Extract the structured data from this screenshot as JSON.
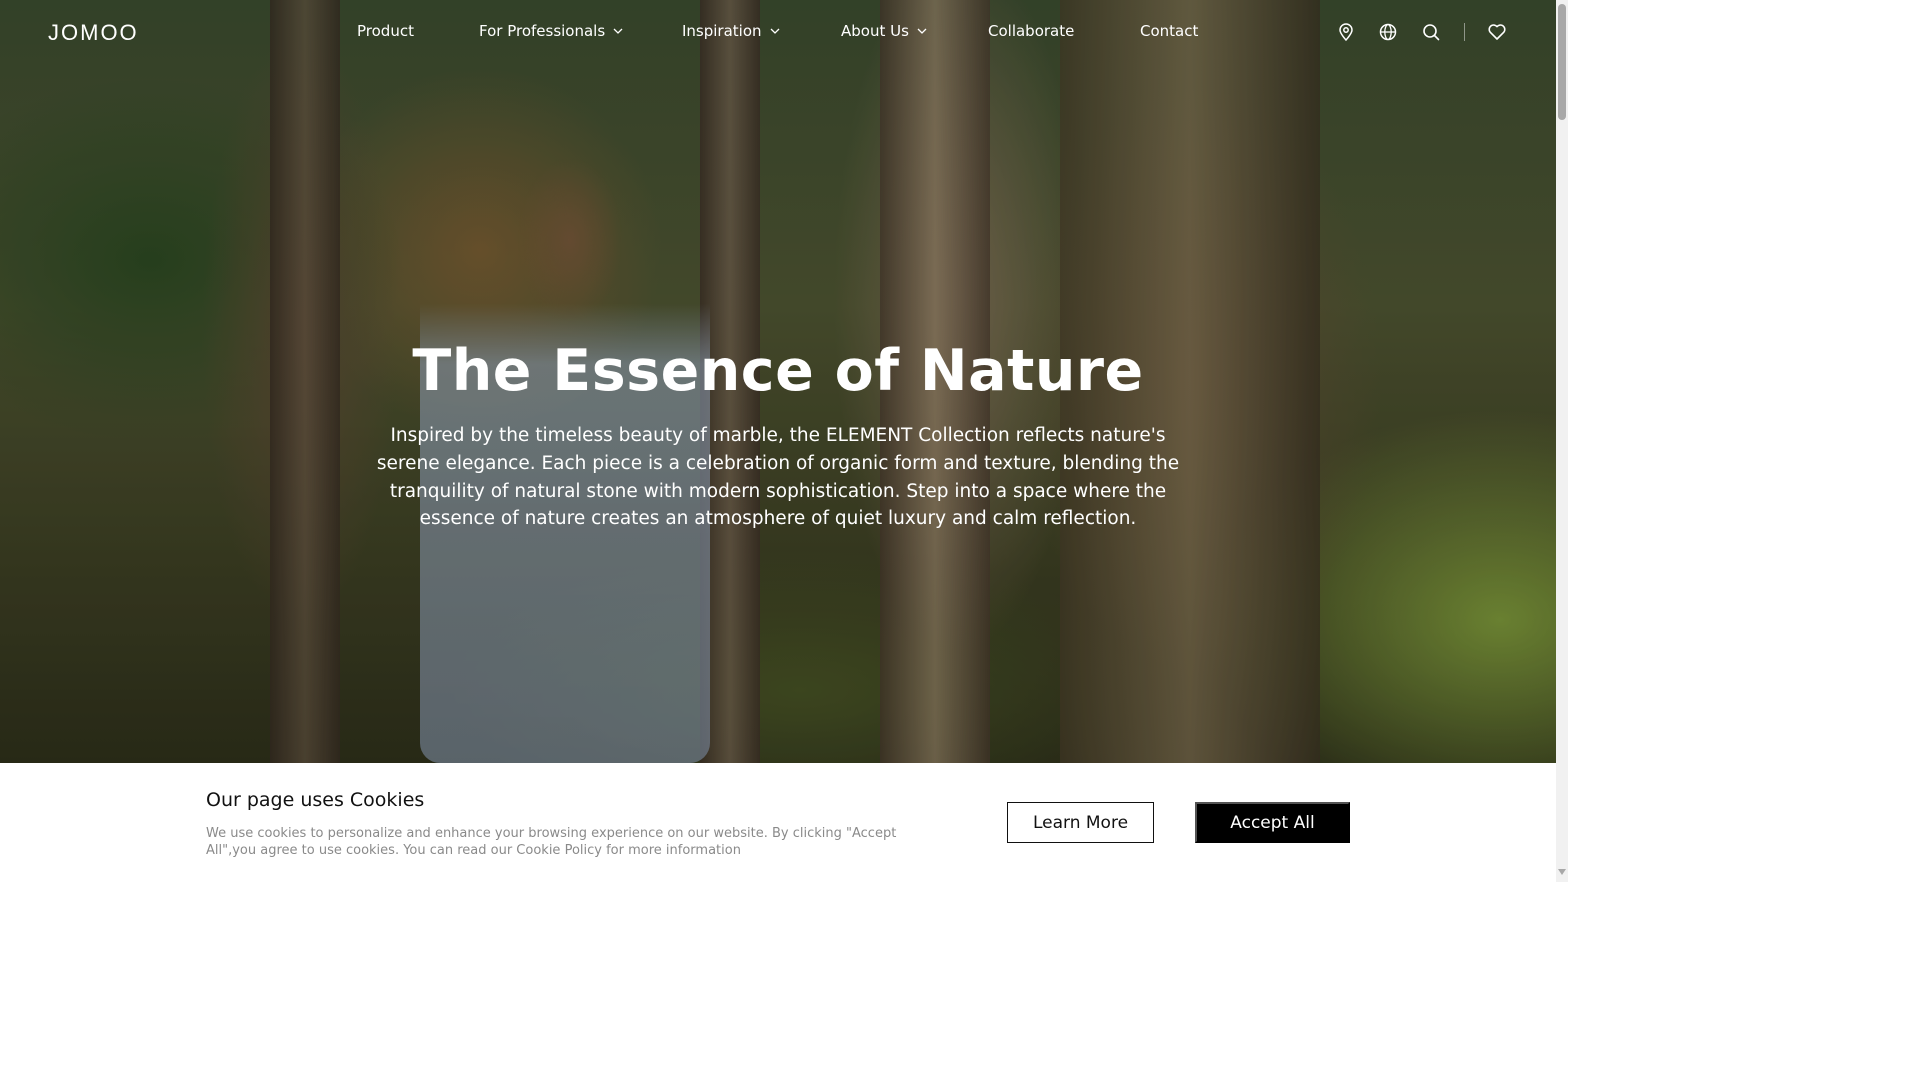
{
  "brand": {
    "logo_text": "JOMOO"
  },
  "nav": {
    "items": [
      {
        "label": "Product",
        "has_dropdown": false
      },
      {
        "label": "For Professionals",
        "has_dropdown": true
      },
      {
        "label": "Inspiration",
        "has_dropdown": true
      },
      {
        "label": "About Us",
        "has_dropdown": true
      },
      {
        "label": "Collaborate",
        "has_dropdown": false
      },
      {
        "label": "Contact",
        "has_dropdown": false
      }
    ],
    "icons": [
      "location-pin-icon",
      "globe-icon",
      "search-icon",
      "heart-icon"
    ]
  },
  "hero": {
    "title": "The Essence of Nature",
    "description": "Inspired by the timeless beauty of marble, the ELEMENT Collection reflects nature's serene elegance. Each piece is a celebration of organic form and texture, blending the tranquility of natural stone with modern sophistication. Step into a space where the essence of nature creates an atmosphere of quiet luxury and calm reflection."
  },
  "cookie_banner": {
    "title": "Our page uses Cookies",
    "text": "We use cookies to personalize and enhance your browsing experience on our website. By clicking \"Accept All\",you agree to use cookies. You can read our Cookie Policy for more information",
    "learn_more_label": "Learn More",
    "accept_all_label": "Accept All"
  },
  "colors": {
    "text_on_hero": "#ffffff",
    "banner_bg": "#ffffff",
    "accept_button_bg": "#000000",
    "cookie_text": "#8a8a8a"
  }
}
